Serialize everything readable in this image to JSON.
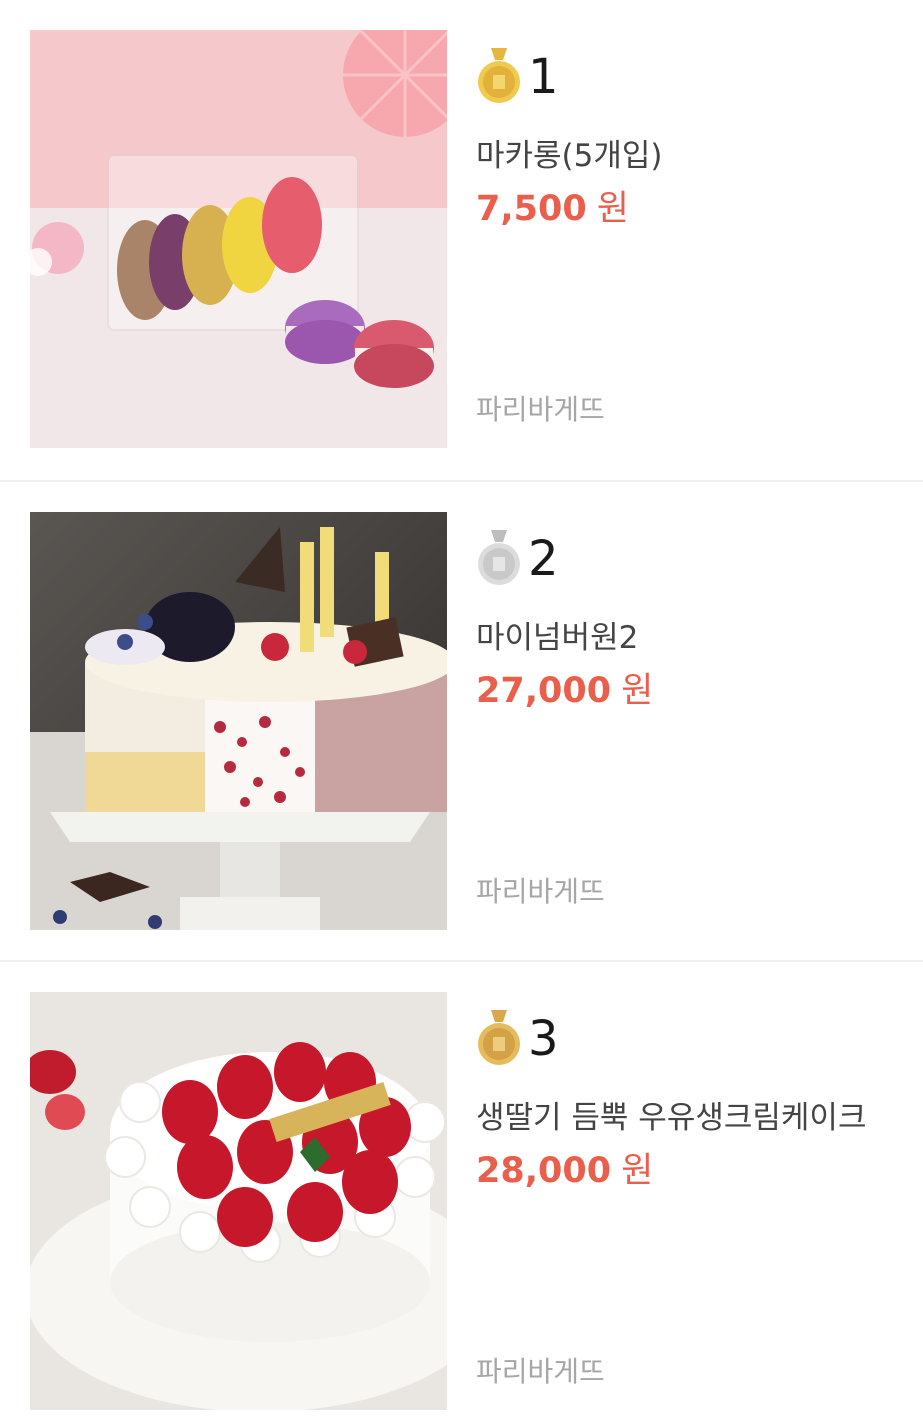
{
  "items": [
    {
      "rank": "1",
      "medal": "gold-medal-icon",
      "name": "마카롱(5개입)",
      "price": "7,500",
      "currency": "원",
      "brand": "파리바게뜨",
      "image": "macaron-box-photo"
    },
    {
      "rank": "2",
      "medal": "silver-medal-icon",
      "name": "마이넘버원2",
      "price": "27,000",
      "currency": "원",
      "brand": "파리바게뜨",
      "image": "my-number-one-cake-photo"
    },
    {
      "rank": "3",
      "medal": "bronze-medal-icon",
      "name": "생딸기 듬뿍 우유생크림케이크",
      "price": "28,000",
      "currency": "원",
      "brand": "파리바게뜨",
      "image": "strawberry-cream-cake-photo"
    }
  ],
  "colors": {
    "price": "#ea5e4c",
    "brand": "#a6a6a6",
    "gold": "#e7b63d",
    "silver": "#c9c9c9",
    "bronze": "#d9a84a"
  }
}
